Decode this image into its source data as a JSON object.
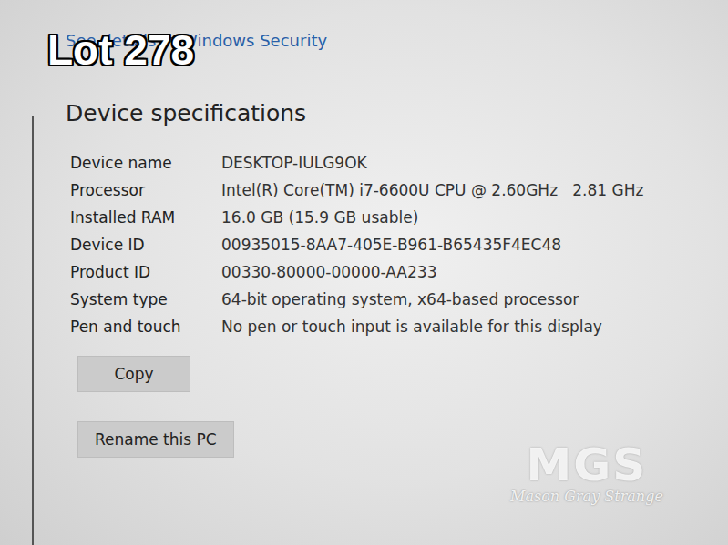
{
  "overlay": {
    "lot": "Lot 278"
  },
  "link": "See details in Windows Security",
  "heading": "Device specifications",
  "specs": [
    {
      "label": "Device name",
      "value": "DESKTOP-IULG9OK"
    },
    {
      "label": "Processor",
      "value": "Intel(R) Core(TM) i7-6600U CPU @ 2.60GHz   2.81 GHz"
    },
    {
      "label": "Installed RAM",
      "value": "16.0 GB (15.9 GB usable)"
    },
    {
      "label": "Device ID",
      "value": "00935015-8AA7-405E-B961-B65435F4EC48"
    },
    {
      "label": "Product ID",
      "value": "00330-80000-00000-AA233"
    },
    {
      "label": "System type",
      "value": "64-bit operating system, x64-based processor"
    },
    {
      "label": "Pen and touch",
      "value": "No pen or touch input is available for this display"
    }
  ],
  "buttons": [
    "Copy",
    "Rename this PC"
  ],
  "watermark": {
    "logo": "MGS",
    "name": "Mason Gray Strange"
  }
}
